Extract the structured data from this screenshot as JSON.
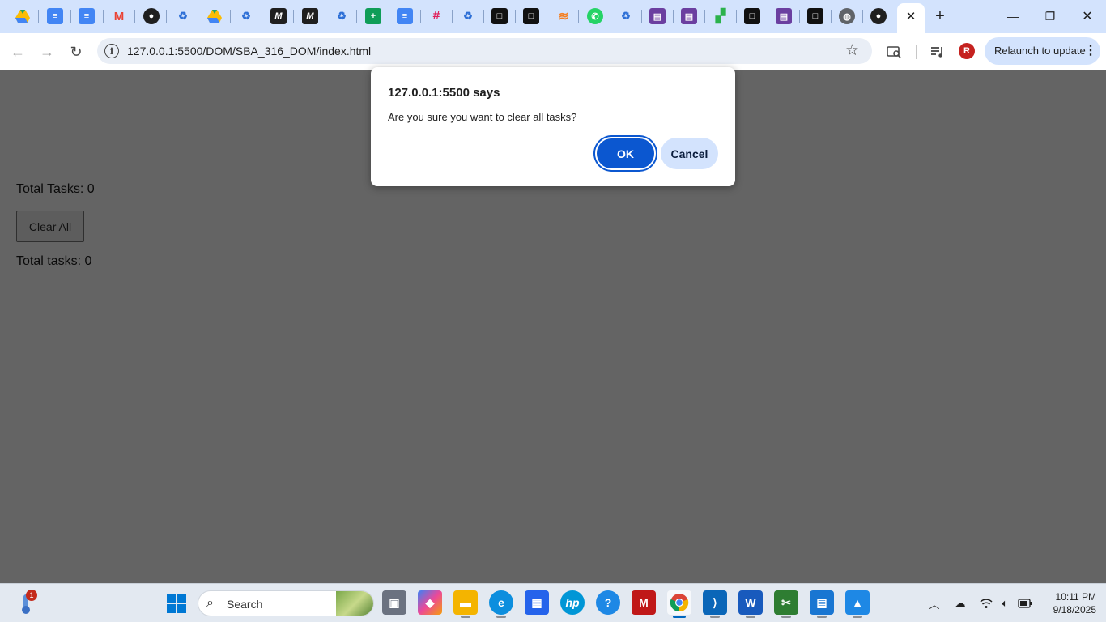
{
  "browser": {
    "active_tab_close": "✕",
    "new_tab": "+",
    "window_controls": {
      "minimize": "—",
      "maximize": "❐",
      "close": "✕"
    },
    "url": "127.0.0.1:5500/DOM/SBA_316_DOM/index.html",
    "profile_initial": "R",
    "relaunch_label": "Relaunch to update",
    "menu_glyph": "⋮"
  },
  "page": {
    "total_heading": "Total Tasks: 0",
    "clear_button": "Clear All",
    "total_count": "Total tasks: 0"
  },
  "dialog": {
    "title": "127.0.0.1:5500 says",
    "message": "Are you sure you want to clear all tasks?",
    "ok": "OK",
    "cancel": "Cancel"
  },
  "taskbar": {
    "search_placeholder": "Search",
    "notification_badge": "1",
    "time": "10:11 PM",
    "date": "9/18/2025"
  },
  "colors": {
    "accent": "#0b57d0",
    "tabstrip": "#d3e3fd",
    "page_overlay": "#646464"
  }
}
